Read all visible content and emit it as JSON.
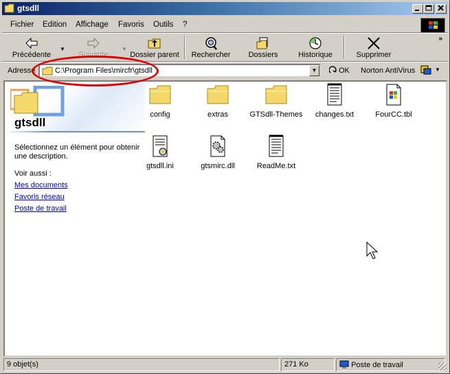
{
  "window": {
    "title": "gtsdll",
    "controls": [
      "minimize-icon",
      "maximize-icon",
      "close-icon"
    ]
  },
  "menu": {
    "items": [
      "Fichier",
      "Edition",
      "Affichage",
      "Favoris",
      "Outils",
      "?"
    ]
  },
  "toolbar": {
    "back": "Précédente",
    "forward": "Suivante",
    "up": "Dossier parent",
    "search": "Rechercher",
    "folders": "Dossiers",
    "history": "Historique",
    "delete": "Supprimer"
  },
  "address": {
    "label": "Adresse",
    "value": "C:\\Program Files\\mircfr\\gtsdll",
    "go": "OK",
    "norton": "Norton AntiVirus"
  },
  "sidepanel": {
    "title": "gtsdll",
    "description": "Sélectionnez un élément pour obtenir une description.",
    "see_also": "Voir aussi :",
    "links": [
      "Mes documents",
      "Favoris réseau",
      "Poste de travail"
    ]
  },
  "files": [
    {
      "name": "config",
      "icon": "folder-icon"
    },
    {
      "name": "extras",
      "icon": "folder-icon"
    },
    {
      "name": "GTSdll-Themes",
      "icon": "folder-icon"
    },
    {
      "name": "changes.txt",
      "icon": "text-file-icon"
    },
    {
      "name": "FourCC.tbl",
      "icon": "tbl-file-icon"
    },
    {
      "name": "gtsdll.ini",
      "icon": "ini-file-icon"
    },
    {
      "name": "gtsmirc.dll",
      "icon": "dll-file-icon"
    },
    {
      "name": "ReadMe.txt",
      "icon": "text-file-icon"
    }
  ],
  "status": {
    "count": "9 objet(s)",
    "size": "271 Ko",
    "location": "Poste de travail"
  },
  "colors": {
    "title_start": "#0a246a",
    "title_end": "#a6caf0",
    "highlight": "#e00000",
    "link": "#0000cc"
  }
}
